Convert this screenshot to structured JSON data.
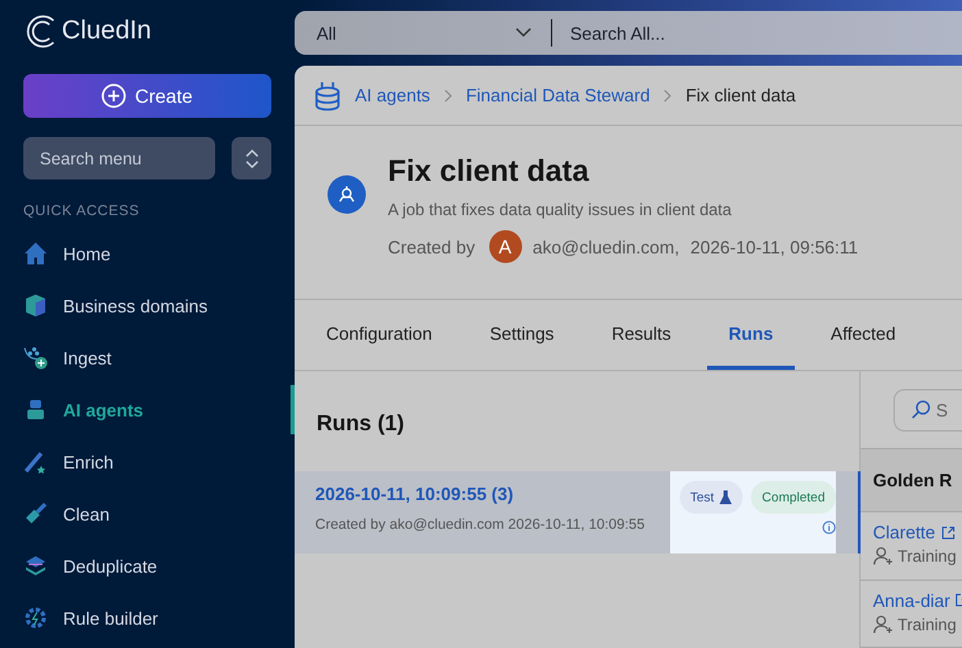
{
  "sidebar": {
    "logo": "CluedIn",
    "create_button": "Create",
    "search": {
      "placeholder": "Search menu"
    },
    "section_title": "QUICK ACCESS",
    "items": [
      {
        "label": "Home",
        "selected": false
      },
      {
        "label": "Business domains",
        "selected": false
      },
      {
        "label": "Ingest",
        "selected": false
      },
      {
        "label": "AI agents",
        "selected": true
      },
      {
        "label": "Enrich",
        "selected": false
      },
      {
        "label": "Clean",
        "selected": false
      },
      {
        "label": "Deduplicate",
        "selected": false
      },
      {
        "label": "Rule builder",
        "selected": false
      }
    ]
  },
  "topbar": {
    "scope": "All",
    "search": {
      "placeholder": "Search All..."
    }
  },
  "breadcrumb": [
    "AI agents",
    "Financial Data Steward",
    "Fix client data"
  ],
  "header": {
    "title": "Fix client data",
    "description": "A job that fixes data quality issues in client data",
    "created_label": "Created by",
    "avatar": "A",
    "author": "ako@cluedin.com,",
    "date": "2026-10-11, 09:56:11"
  },
  "tabs": [
    {
      "label": "Configuration",
      "selected": false
    },
    {
      "label": "Settings",
      "selected": false
    },
    {
      "label": "Results",
      "selected": false
    },
    {
      "label": "Runs",
      "selected": true
    },
    {
      "label": "Affected",
      "selected": false
    }
  ],
  "runs": {
    "title": "Runs (1)",
    "items": [
      {
        "title": "2026-10-11, 10:09:55 (3)",
        "subtitle": "Created by ako@cluedin.com 2026-10-11, 10:09:55",
        "type": "Test",
        "status": "Completed",
        "selected": true
      }
    ]
  },
  "records": {
    "search": {
      "placeholder": "S"
    },
    "column": "Golden R",
    "rows": [
      {
        "name": "Clarette",
        "source": "Training"
      },
      {
        "name": "Anna-diar",
        "source": "Training"
      }
    ]
  }
}
